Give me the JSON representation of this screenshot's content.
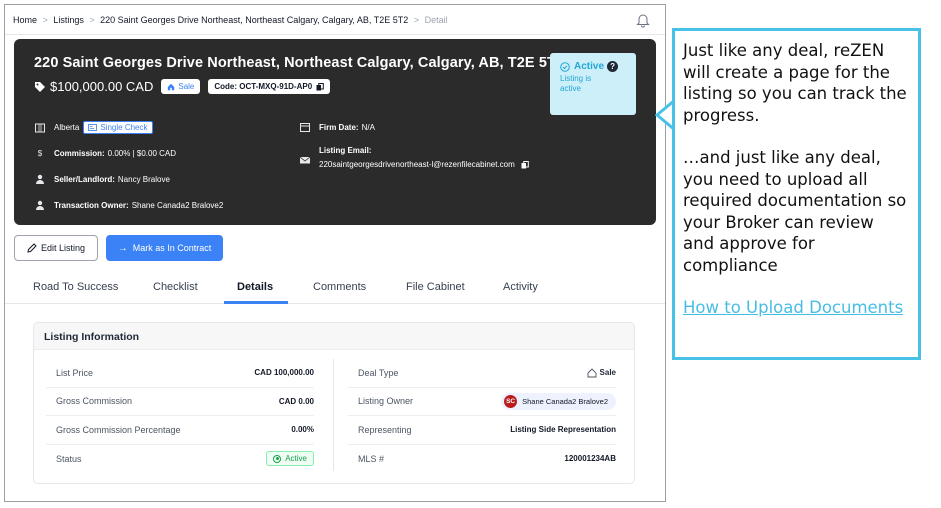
{
  "breadcrumb": {
    "items": [
      "Home",
      "Listings",
      "220 Saint Georges Drive Northeast, Northeast Calgary, Calgary, AB, T2E 5T2"
    ],
    "current": "Detail",
    "separator": ">"
  },
  "listing": {
    "title": "220 Saint Georges Drive Northeast, Northeast Calgary, Calgary, AB, T2E 5T2",
    "price": "$100,000.00 CAD",
    "sale_pill": "Sale",
    "code": "Code: OCT-MXQ-91D-AP0",
    "status": {
      "label": "Active",
      "help": "?",
      "sub": "Listing is active"
    },
    "province": "Alberta",
    "check_pill": "Single Check",
    "commission_label": "Commission:",
    "commission_value": "0.00% | $0.00 CAD",
    "seller_label": "Seller/Landlord:",
    "seller_value": "Nancy Bralove",
    "owner_label": "Transaction Owner:",
    "owner_value": "Shane Canada2 Bralove2",
    "firm_label": "Firm Date:",
    "firm_value": "N/A",
    "email_label": "Listing Email:",
    "email_value": "220saintgeorgesdrivenortheast-l@rezenfilecabinet.com"
  },
  "actions": {
    "edit": "Edit Listing",
    "contract": "Mark as In Contract"
  },
  "tabs": [
    "Road To Success",
    "Checklist",
    "Details",
    "Comments",
    "File Cabinet",
    "Activity"
  ],
  "active_tab": "Details",
  "info": {
    "heading": "Listing Information",
    "left": [
      {
        "label": "List Price",
        "value": "CAD 100,000.00"
      },
      {
        "label": "Gross Commission",
        "value": "CAD 0.00"
      },
      {
        "label": "Gross Commission Percentage",
        "value": "0.00%"
      },
      {
        "label": "Status",
        "value": "Active"
      }
    ],
    "right": [
      {
        "label": "Deal Type",
        "value": "Sale"
      },
      {
        "label": "Listing Owner",
        "value": "Shane Canada2 Bralove2",
        "avatar": "SC"
      },
      {
        "label": "Representing",
        "value": "Listing Side Representation"
      },
      {
        "label": "MLS #",
        "value": "120001234AB"
      }
    ]
  },
  "callout": {
    "p1": "Just like any deal, reZEN will create a page for the listing so you can track the progress.",
    "p2": "…and just like any deal, you need to upload all required documentation so your Broker can review and approve for compliance",
    "link": "How to Upload Documents"
  },
  "colors": {
    "accent": "#3b82f6",
    "header_bg": "#2b2b2b",
    "status_bg": "#cdeff9",
    "callout_border": "#47c2e6",
    "active_green": "#16a34a"
  }
}
